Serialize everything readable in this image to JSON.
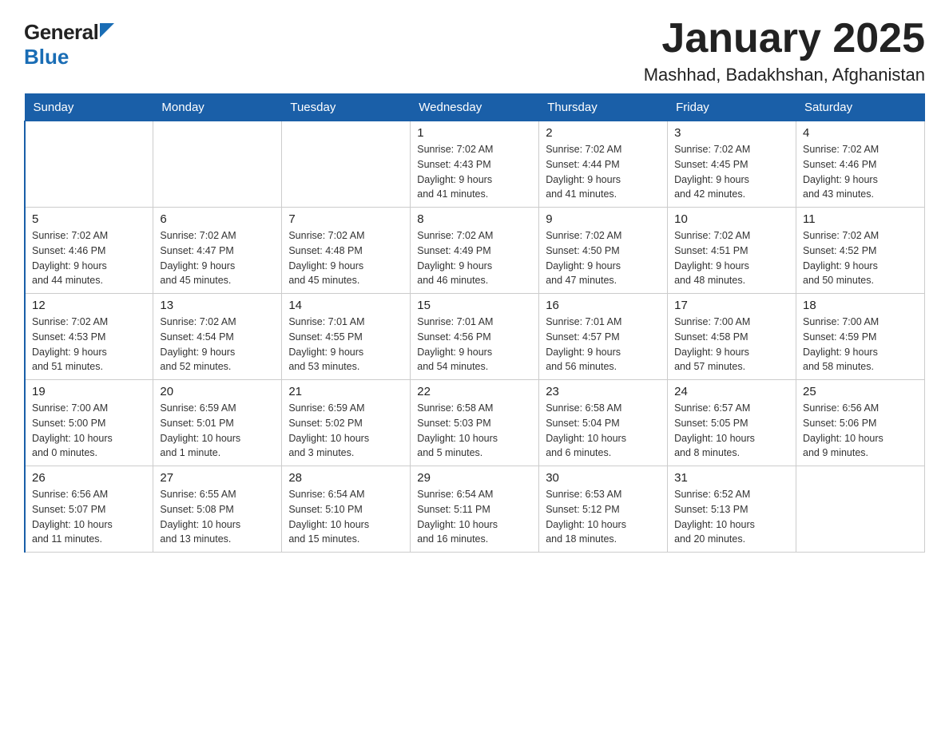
{
  "header": {
    "logo_general": "General",
    "logo_blue": "Blue",
    "title": "January 2025",
    "subtitle": "Mashhad, Badakhshan, Afghanistan"
  },
  "weekdays": [
    "Sunday",
    "Monday",
    "Tuesday",
    "Wednesday",
    "Thursday",
    "Friday",
    "Saturday"
  ],
  "weeks": [
    [
      {
        "day": "",
        "info": ""
      },
      {
        "day": "",
        "info": ""
      },
      {
        "day": "",
        "info": ""
      },
      {
        "day": "1",
        "info": "Sunrise: 7:02 AM\nSunset: 4:43 PM\nDaylight: 9 hours\nand 41 minutes."
      },
      {
        "day": "2",
        "info": "Sunrise: 7:02 AM\nSunset: 4:44 PM\nDaylight: 9 hours\nand 41 minutes."
      },
      {
        "day": "3",
        "info": "Sunrise: 7:02 AM\nSunset: 4:45 PM\nDaylight: 9 hours\nand 42 minutes."
      },
      {
        "day": "4",
        "info": "Sunrise: 7:02 AM\nSunset: 4:46 PM\nDaylight: 9 hours\nand 43 minutes."
      }
    ],
    [
      {
        "day": "5",
        "info": "Sunrise: 7:02 AM\nSunset: 4:46 PM\nDaylight: 9 hours\nand 44 minutes."
      },
      {
        "day": "6",
        "info": "Sunrise: 7:02 AM\nSunset: 4:47 PM\nDaylight: 9 hours\nand 45 minutes."
      },
      {
        "day": "7",
        "info": "Sunrise: 7:02 AM\nSunset: 4:48 PM\nDaylight: 9 hours\nand 45 minutes."
      },
      {
        "day": "8",
        "info": "Sunrise: 7:02 AM\nSunset: 4:49 PM\nDaylight: 9 hours\nand 46 minutes."
      },
      {
        "day": "9",
        "info": "Sunrise: 7:02 AM\nSunset: 4:50 PM\nDaylight: 9 hours\nand 47 minutes."
      },
      {
        "day": "10",
        "info": "Sunrise: 7:02 AM\nSunset: 4:51 PM\nDaylight: 9 hours\nand 48 minutes."
      },
      {
        "day": "11",
        "info": "Sunrise: 7:02 AM\nSunset: 4:52 PM\nDaylight: 9 hours\nand 50 minutes."
      }
    ],
    [
      {
        "day": "12",
        "info": "Sunrise: 7:02 AM\nSunset: 4:53 PM\nDaylight: 9 hours\nand 51 minutes."
      },
      {
        "day": "13",
        "info": "Sunrise: 7:02 AM\nSunset: 4:54 PM\nDaylight: 9 hours\nand 52 minutes."
      },
      {
        "day": "14",
        "info": "Sunrise: 7:01 AM\nSunset: 4:55 PM\nDaylight: 9 hours\nand 53 minutes."
      },
      {
        "day": "15",
        "info": "Sunrise: 7:01 AM\nSunset: 4:56 PM\nDaylight: 9 hours\nand 54 minutes."
      },
      {
        "day": "16",
        "info": "Sunrise: 7:01 AM\nSunset: 4:57 PM\nDaylight: 9 hours\nand 56 minutes."
      },
      {
        "day": "17",
        "info": "Sunrise: 7:00 AM\nSunset: 4:58 PM\nDaylight: 9 hours\nand 57 minutes."
      },
      {
        "day": "18",
        "info": "Sunrise: 7:00 AM\nSunset: 4:59 PM\nDaylight: 9 hours\nand 58 minutes."
      }
    ],
    [
      {
        "day": "19",
        "info": "Sunrise: 7:00 AM\nSunset: 5:00 PM\nDaylight: 10 hours\nand 0 minutes."
      },
      {
        "day": "20",
        "info": "Sunrise: 6:59 AM\nSunset: 5:01 PM\nDaylight: 10 hours\nand 1 minute."
      },
      {
        "day": "21",
        "info": "Sunrise: 6:59 AM\nSunset: 5:02 PM\nDaylight: 10 hours\nand 3 minutes."
      },
      {
        "day": "22",
        "info": "Sunrise: 6:58 AM\nSunset: 5:03 PM\nDaylight: 10 hours\nand 5 minutes."
      },
      {
        "day": "23",
        "info": "Sunrise: 6:58 AM\nSunset: 5:04 PM\nDaylight: 10 hours\nand 6 minutes."
      },
      {
        "day": "24",
        "info": "Sunrise: 6:57 AM\nSunset: 5:05 PM\nDaylight: 10 hours\nand 8 minutes."
      },
      {
        "day": "25",
        "info": "Sunrise: 6:56 AM\nSunset: 5:06 PM\nDaylight: 10 hours\nand 9 minutes."
      }
    ],
    [
      {
        "day": "26",
        "info": "Sunrise: 6:56 AM\nSunset: 5:07 PM\nDaylight: 10 hours\nand 11 minutes."
      },
      {
        "day": "27",
        "info": "Sunrise: 6:55 AM\nSunset: 5:08 PM\nDaylight: 10 hours\nand 13 minutes."
      },
      {
        "day": "28",
        "info": "Sunrise: 6:54 AM\nSunset: 5:10 PM\nDaylight: 10 hours\nand 15 minutes."
      },
      {
        "day": "29",
        "info": "Sunrise: 6:54 AM\nSunset: 5:11 PM\nDaylight: 10 hours\nand 16 minutes."
      },
      {
        "day": "30",
        "info": "Sunrise: 6:53 AM\nSunset: 5:12 PM\nDaylight: 10 hours\nand 18 minutes."
      },
      {
        "day": "31",
        "info": "Sunrise: 6:52 AM\nSunset: 5:13 PM\nDaylight: 10 hours\nand 20 minutes."
      },
      {
        "day": "",
        "info": ""
      }
    ]
  ]
}
